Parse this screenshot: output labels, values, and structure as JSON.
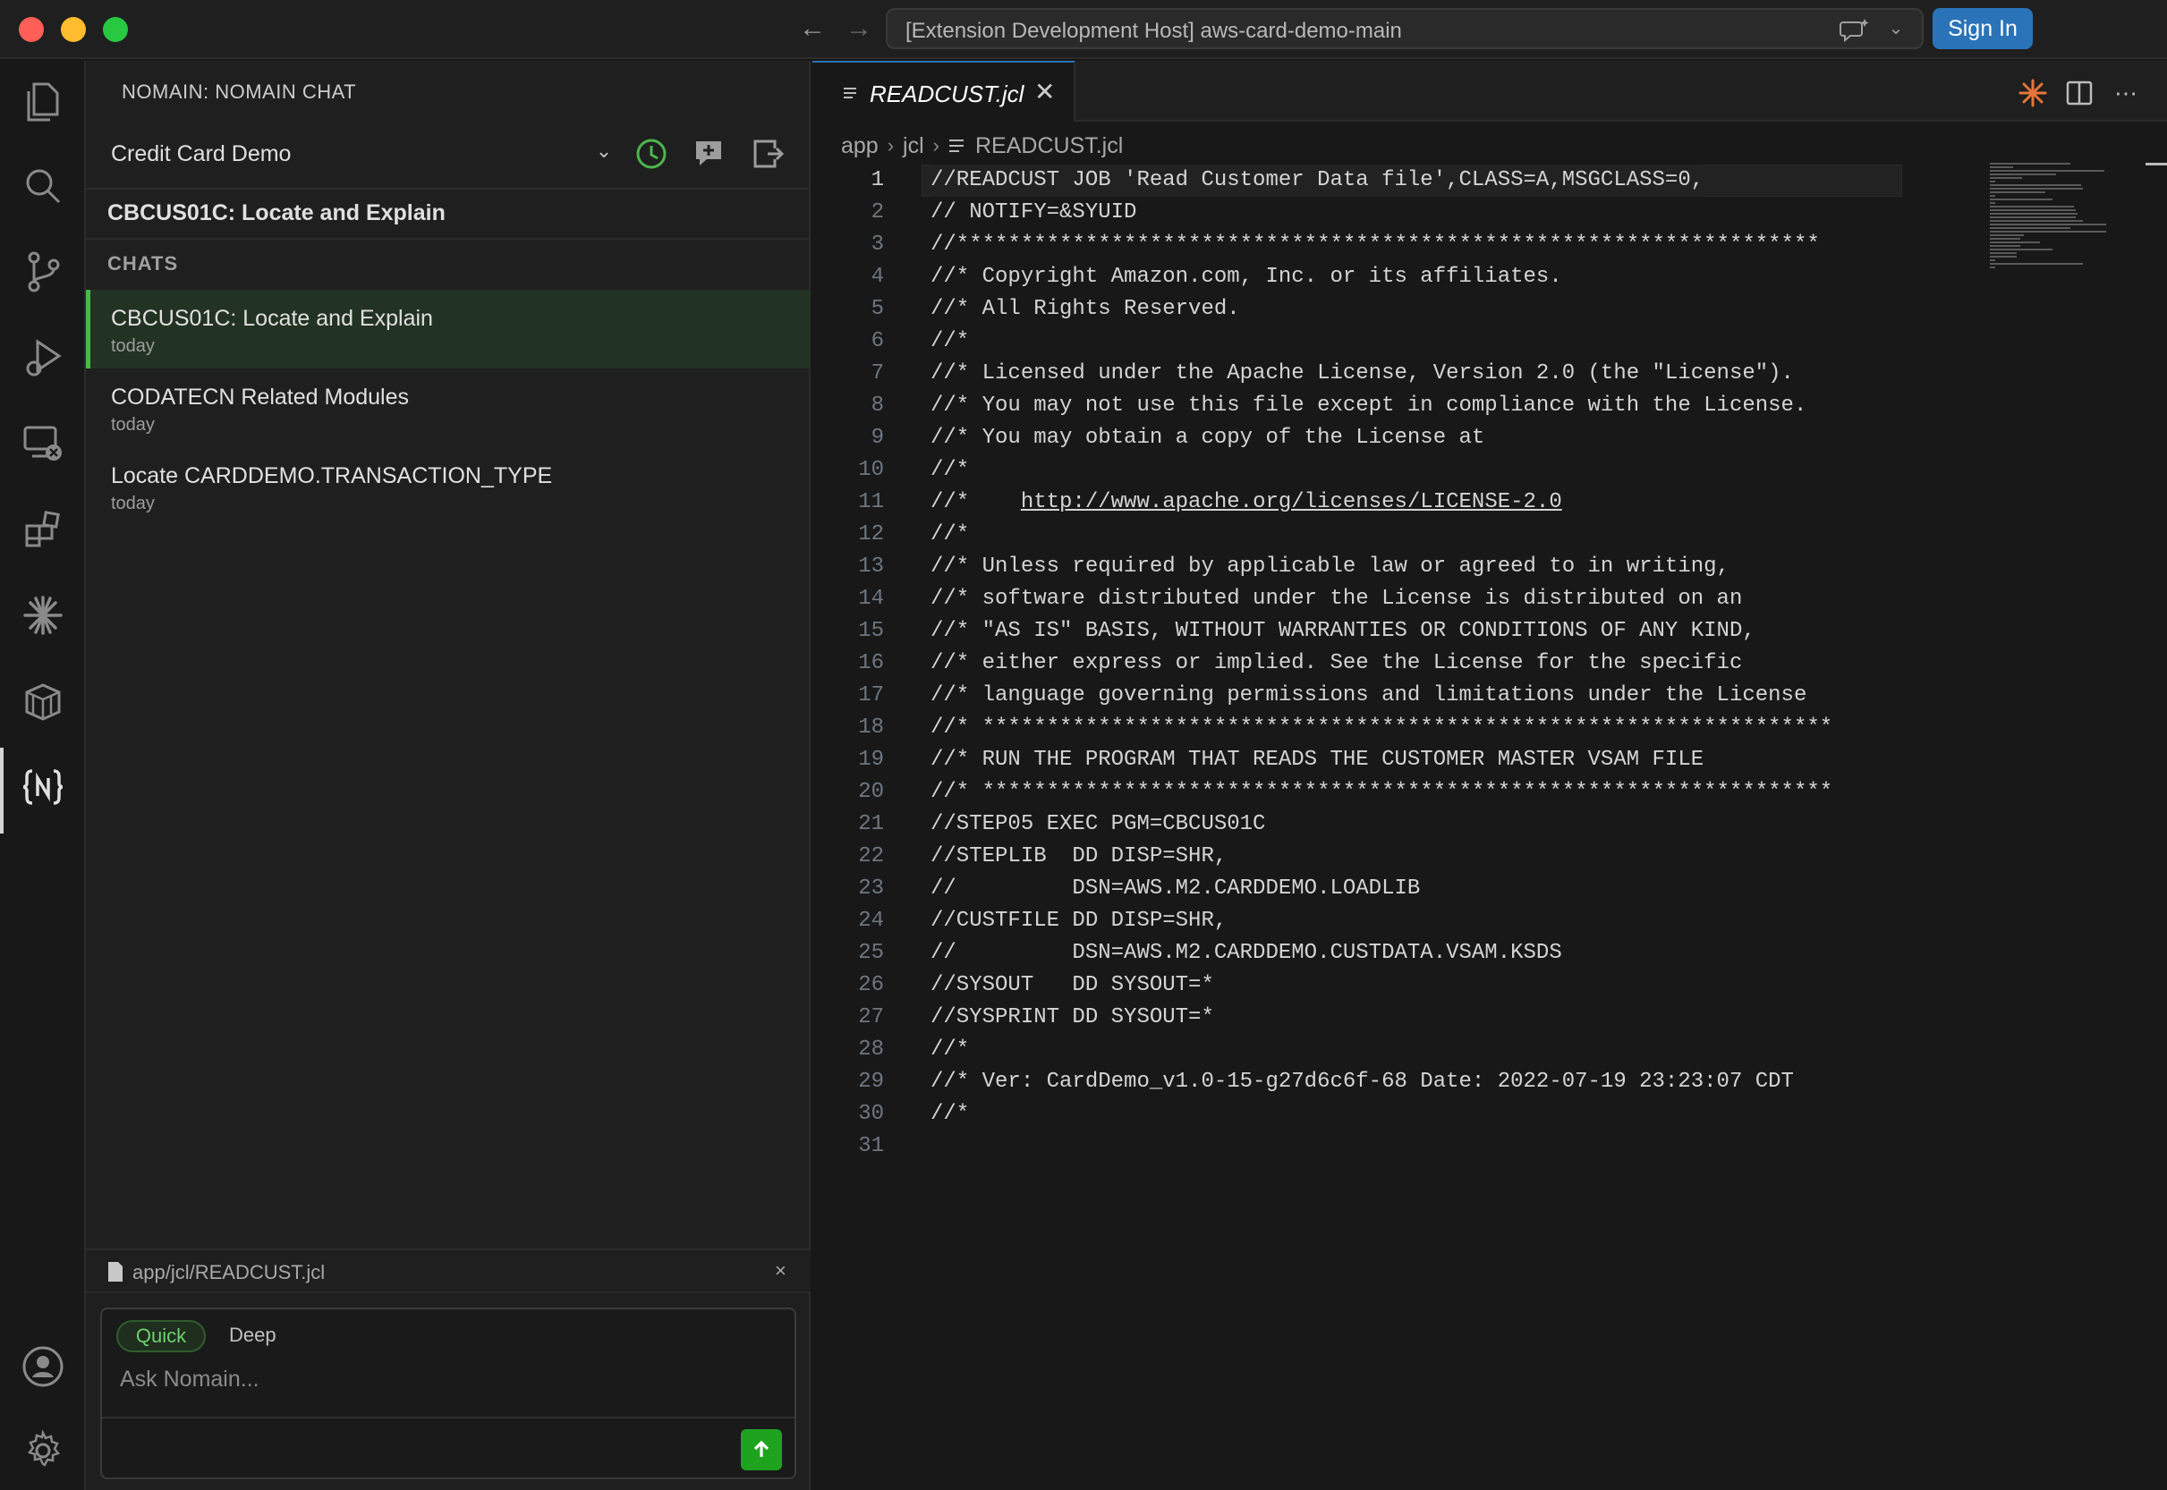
{
  "titlebar": {
    "command_center": "[Extension Development Host] aws-card-demo-main",
    "sign_in": "Sign In"
  },
  "sidebar": {
    "title": "NOMAIN: NOMAIN CHAT",
    "project": "Credit Card Demo",
    "current_chat": "CBCUS01C: Locate and Explain",
    "chats_header": "CHATS",
    "chats": [
      {
        "title": "CBCUS01C: Locate and Explain",
        "date": "today"
      },
      {
        "title": "CODATECN Related Modules",
        "date": "today"
      },
      {
        "title": "Locate CARDDEMO.TRANSACTION_TYPE",
        "date": "today"
      }
    ],
    "context_file": "app/jcl/READCUST.jcl",
    "context_close": "×",
    "modes": {
      "quick": "Quick",
      "deep": "Deep"
    },
    "ask_placeholder": "Ask Nomain..."
  },
  "editor": {
    "tab_label": "READCUST.jcl",
    "tab_close": "✕",
    "breadcrumb": [
      "app",
      "jcl",
      "READCUST.jcl"
    ],
    "lines": [
      "//READCUST JOB 'Read Customer Data file',CLASS=A,MSGCLASS=0,",
      "// NOTIFY=&SYUID",
      "//*******************************************************************",
      "//* Copyright Amazon.com, Inc. or its affiliates.",
      "//* All Rights Reserved.",
      "//*",
      "//* Licensed under the Apache License, Version 2.0 (the \"License\").",
      "//* You may not use this file except in compliance with the License.",
      "//* You may obtain a copy of the License at",
      "//*",
      "//*    http://www.apache.org/licenses/LICENSE-2.0",
      "//*",
      "//* Unless required by applicable law or agreed to in writing,",
      "//* software distributed under the License is distributed on an",
      "//* \"AS IS\" BASIS, WITHOUT WARRANTIES OR CONDITIONS OF ANY KIND,",
      "//* either express or implied. See the License for the specific",
      "//* language governing permissions and limitations under the License",
      "//* ******************************************************************",
      "//* RUN THE PROGRAM THAT READS THE CUSTOMER MASTER VSAM FILE",
      "//* ******************************************************************",
      "//STEP05 EXEC PGM=CBCUS01C",
      "//STEPLIB  DD DISP=SHR,",
      "//         DSN=AWS.M2.CARDDEMO.LOADLIB",
      "//CUSTFILE DD DISP=SHR,",
      "//         DSN=AWS.M2.CARDDEMO.CUSTDATA.VSAM.KSDS",
      "//SYSOUT   DD SYSOUT=*",
      "//SYSPRINT DD SYSOUT=*",
      "//*",
      "//* Ver: CardDemo_v1.0-15-g27d6c6f-68 Date: 2022-07-19 23:23:07 CDT",
      "//*",
      ""
    ],
    "current_line": 1,
    "link_text": "http://www.apache.org/licenses/LICENSE-2.0"
  },
  "colors": {
    "accent_blue": "#2a73b8",
    "active_green": "#4cb64c",
    "send_green": "#1ea31e"
  }
}
